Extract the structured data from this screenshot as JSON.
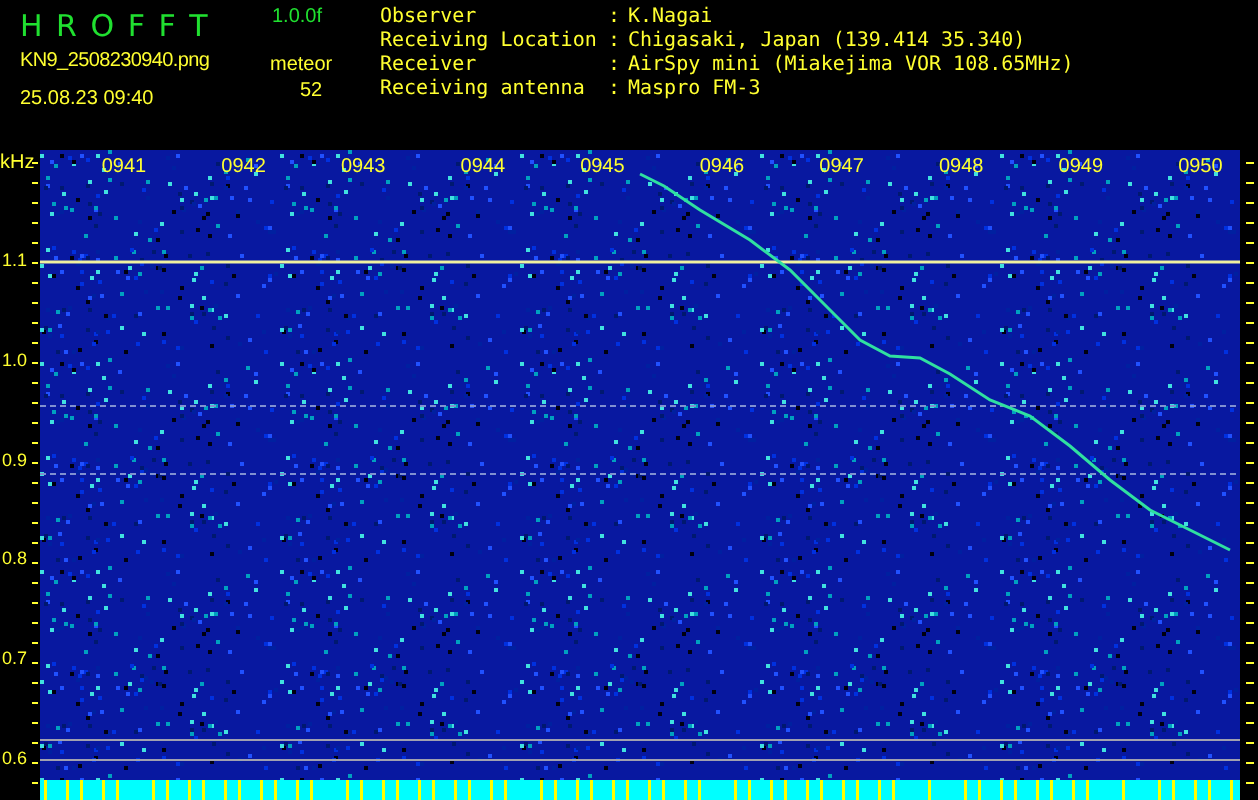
{
  "header": {
    "title": "H R O F F T",
    "version": "1.0.0f",
    "file_name": "KN9_2508230940.png",
    "meteor_label": "meteor",
    "timestamp": "25.08.23 09:40",
    "meteor_count": "52"
  },
  "station_info": [
    {
      "label": "Observer",
      "separator": ":",
      "value": "K.Nagai"
    },
    {
      "label": "Receiving Location",
      "separator": ":",
      "value": "Chigasaki, Japan (139.414 35.340)"
    },
    {
      "label": "Receiver",
      "separator": ":",
      "value": "AirSpy mini (Miakejima VOR 108.65MHz)"
    },
    {
      "label": "Receiving antenna",
      "separator": ":",
      "value": "Maspro FM-3"
    }
  ],
  "spectrogram": {
    "y_unit": "kHz",
    "y_labels": [
      "1.1",
      "1.0",
      "0.9",
      "0.8",
      "0.7",
      "0.6"
    ],
    "time_labels": [
      "0941",
      "0942",
      "0943",
      "0944",
      "0945",
      "0946",
      "0947",
      "0948",
      "0949",
      "0950"
    ]
  }
}
